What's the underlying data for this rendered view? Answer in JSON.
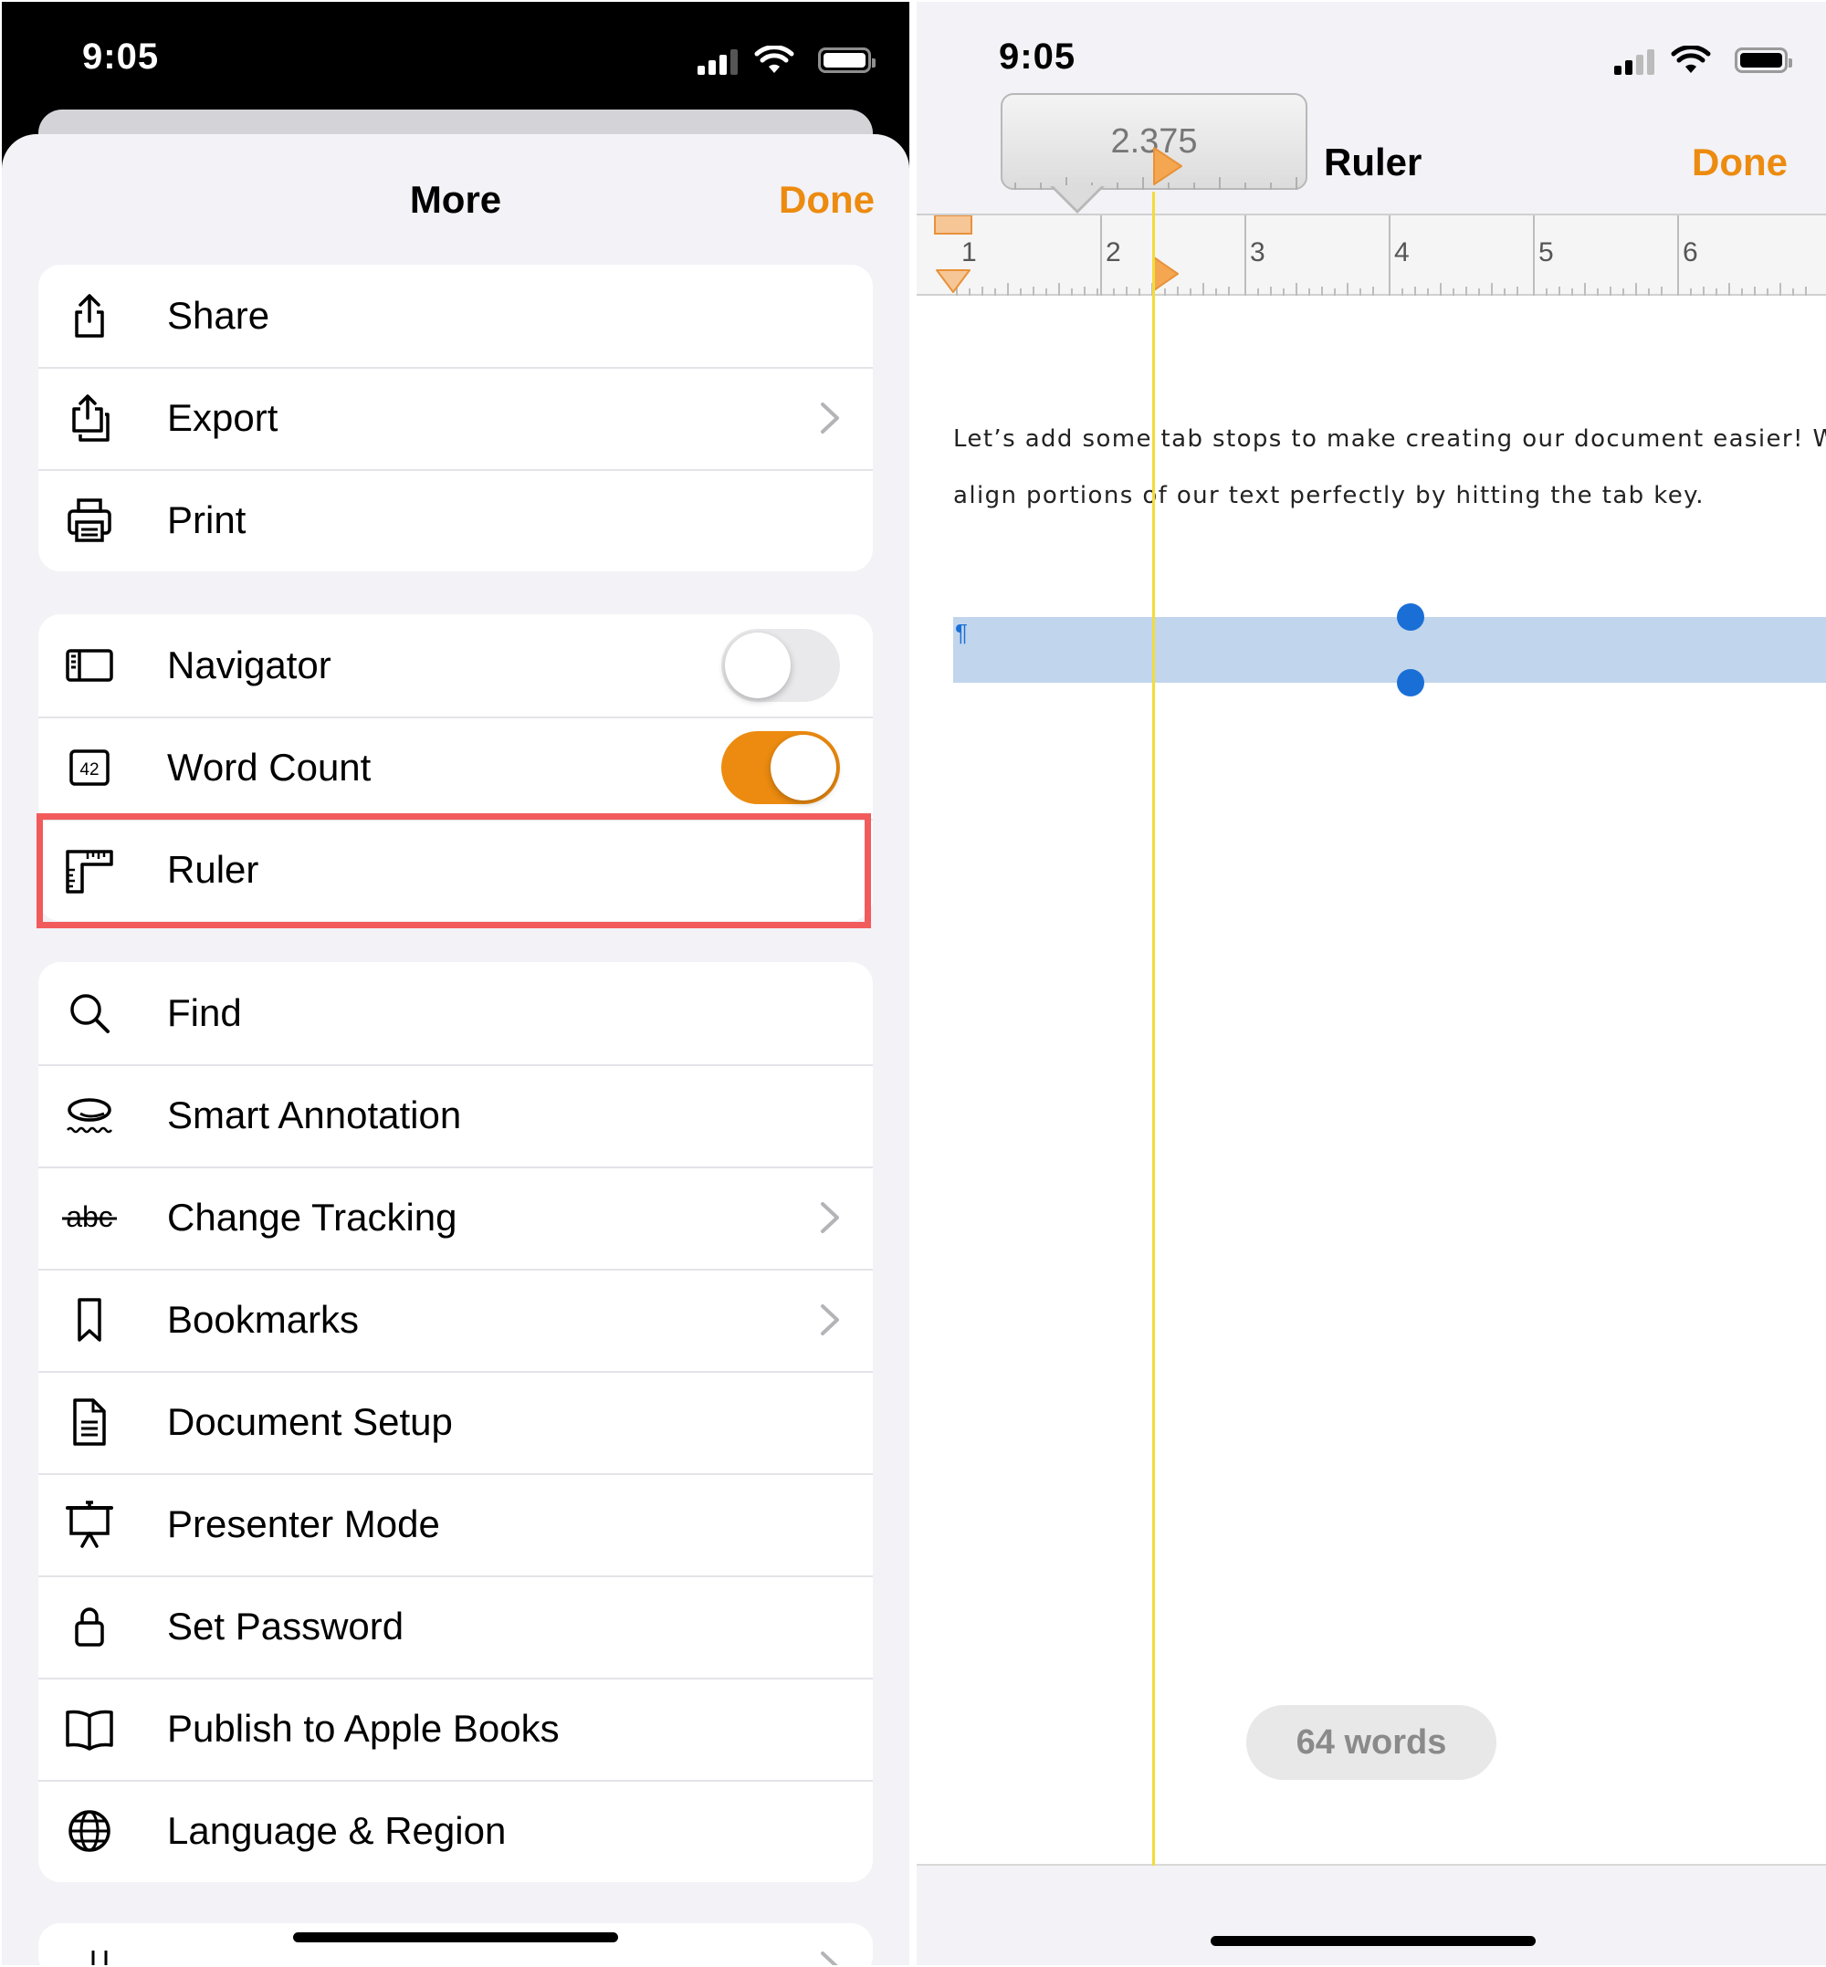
{
  "left": {
    "status_time": "9:05",
    "title": "More",
    "done_label": "Done",
    "groups": [
      {
        "items": [
          {
            "label": "Share",
            "icon": "share-icon"
          },
          {
            "label": "Export",
            "icon": "export-icon",
            "chevron": true
          },
          {
            "label": "Print",
            "icon": "printer-icon"
          }
        ]
      },
      {
        "items": [
          {
            "label": "Navigator",
            "icon": "sidebar-icon",
            "toggle": false
          },
          {
            "label": "Word Count",
            "icon": "word-count-icon",
            "toggle": true
          },
          {
            "label": "Ruler",
            "icon": "ruler-icon",
            "highlighted": true
          }
        ]
      },
      {
        "items": [
          {
            "label": "Find",
            "icon": "magnifier-icon"
          },
          {
            "label": "Smart Annotation",
            "icon": "annotation-icon"
          },
          {
            "label": "Change Tracking",
            "icon": "strikethrough-abc-icon",
            "chevron": true
          },
          {
            "label": "Bookmarks",
            "icon": "bookmark-icon",
            "chevron": true
          },
          {
            "label": "Document Setup",
            "icon": "document-icon"
          },
          {
            "label": "Presenter Mode",
            "icon": "presenter-icon"
          },
          {
            "label": "Set Password",
            "icon": "lock-icon"
          },
          {
            "label": "Publish to Apple Books",
            "icon": "book-icon"
          },
          {
            "label": "Language & Region",
            "icon": "globe-icon"
          }
        ]
      }
    ]
  },
  "right": {
    "status_time": "9:05",
    "title": "Ruler",
    "done_label": "Done",
    "tooltip_value": "2.375",
    "ruler_numbers": [
      "1",
      "2",
      "3",
      "4",
      "5",
      "6"
    ],
    "doc_lines": [
      "Let’s add some tab stops to make creating our document easier! We c",
      "align portions of our text perfectly by hitting the tab key."
    ],
    "pilcrow": "¶",
    "word_count": "64 words"
  },
  "colors": {
    "accent": "#ec8b0f",
    "highlight_border": "#f25b5b",
    "selection": "#c1d5ec",
    "selection_handle": "#1a6fd6",
    "guide_line": "#f2dc3c",
    "ruler_marker": "#f0a050"
  }
}
